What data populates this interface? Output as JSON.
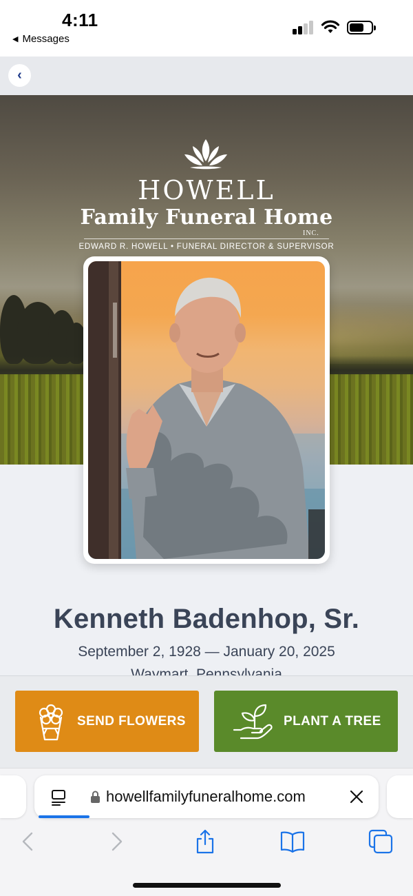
{
  "status_bar": {
    "time": "4:11",
    "back_app_label": "Messages",
    "signal_icon": "cellular-signal-icon",
    "wifi_icon": "wifi-icon",
    "battery_icon": "battery-icon"
  },
  "page_nav": {
    "back_symbol": "‹"
  },
  "logo": {
    "icon": "lotus-icon",
    "line1": "HOWELL",
    "line2": "Family Funeral Home",
    "suffix": "INC.",
    "tagline": "EDWARD R. HOWELL • FUNERAL DIRECTOR & SUPERVISOR"
  },
  "obituary": {
    "name": "Kenneth Badenhop, Sr.",
    "dates": "September 2, 1928 — January 20, 2025",
    "location": "Waymart, Pennsylvania"
  },
  "actions": {
    "send_flowers": {
      "label": "SEND FLOWERS",
      "icon": "flower-bouquet-icon",
      "color": "#df8b16"
    },
    "plant_tree": {
      "label": "PLANT A TREE",
      "icon": "hand-seedling-icon",
      "color": "#5a8a2a"
    }
  },
  "browser": {
    "url": "howellfamilyfuneralhome.com",
    "reader_icon": "reader-mode-icon",
    "lock_icon": "lock-icon",
    "clear_icon": "close-icon",
    "toolbar_icons": [
      "back-arrow-icon",
      "forward-arrow-icon",
      "share-icon",
      "bookmarks-icon",
      "tabs-icon"
    ],
    "accent": "#1a73e8"
  }
}
